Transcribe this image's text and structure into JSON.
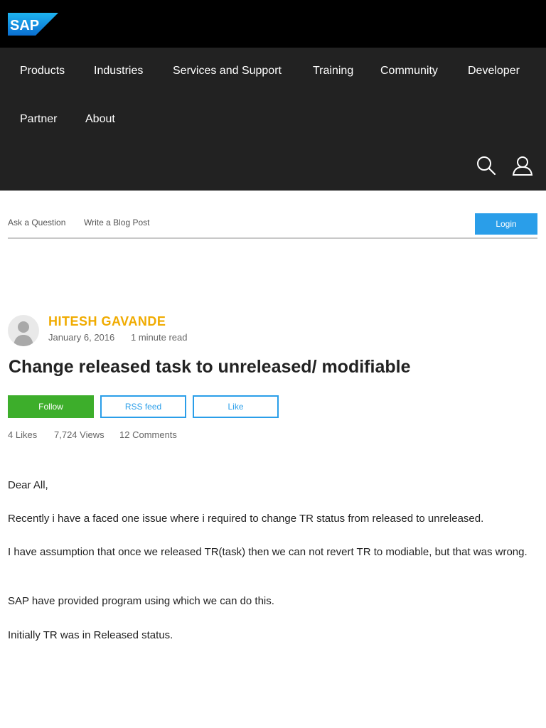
{
  "header": {
    "brand": "SAP",
    "brand_color": "#0a6ed1"
  },
  "nav": {
    "items": [
      {
        "label": "Products"
      },
      {
        "label": "Industries"
      },
      {
        "label": "Services and Support"
      },
      {
        "label": "Training"
      },
      {
        "label": "Community"
      },
      {
        "label": "Developer"
      },
      {
        "label": "Partner"
      },
      {
        "label": "About"
      }
    ],
    "icons": [
      "search-icon",
      "user-icon"
    ]
  },
  "subbar": {
    "ask_question": "Ask a Question",
    "write_blog": "Write a Blog Post",
    "login": "Login"
  },
  "post": {
    "author": "HITESH GAVANDE",
    "date": "January 6, 2016",
    "read_time": "1 minute read",
    "title": "Change released task to unreleased/ modifiable",
    "actions": {
      "follow": "Follow",
      "rss": "RSS feed",
      "like": "Like"
    },
    "stats": {
      "likes": "4 Likes",
      "views": "7,724 Views",
      "comments": "12 Comments"
    },
    "body": [
      "Dear All,",
      "Recently i have a faced one issue where i required to change TR status from released to unreleased.",
      "I have assumption that once we released TR(task) then we can not revert TR to modiable, but that was wrong.",
      "SAP have provided program using which we can do this.",
      "Initially TR was in Released status."
    ]
  },
  "colors": {
    "topbar": "#000000",
    "nav_bg": "#222222",
    "author": "#f0ab00",
    "follow": "#3dae2b",
    "accent": "#2a9ee9"
  }
}
